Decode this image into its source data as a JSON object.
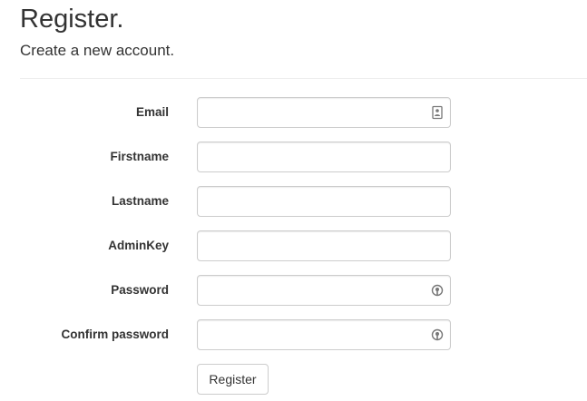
{
  "header": {
    "title": "Register.",
    "subtitle": "Create a new account."
  },
  "form": {
    "fields": [
      {
        "label": "Email",
        "value": "",
        "placeholder": "",
        "type": "email",
        "icon": "contact-card-icon"
      },
      {
        "label": "Firstname",
        "value": "",
        "placeholder": "",
        "type": "text"
      },
      {
        "label": "Lastname",
        "value": "",
        "placeholder": "",
        "type": "text"
      },
      {
        "label": "AdminKey",
        "value": "",
        "placeholder": "",
        "type": "text"
      },
      {
        "label": "Password",
        "value": "",
        "placeholder": "",
        "type": "password",
        "icon": "password-manager-icon"
      },
      {
        "label": "Confirm password",
        "value": "",
        "placeholder": "",
        "type": "password",
        "icon": "password-manager-icon"
      }
    ],
    "submit_label": "Register"
  },
  "colors": {
    "text": "#333333",
    "input_border": "#cccccc",
    "divider": "#eeeeee",
    "icon": "#777777"
  }
}
